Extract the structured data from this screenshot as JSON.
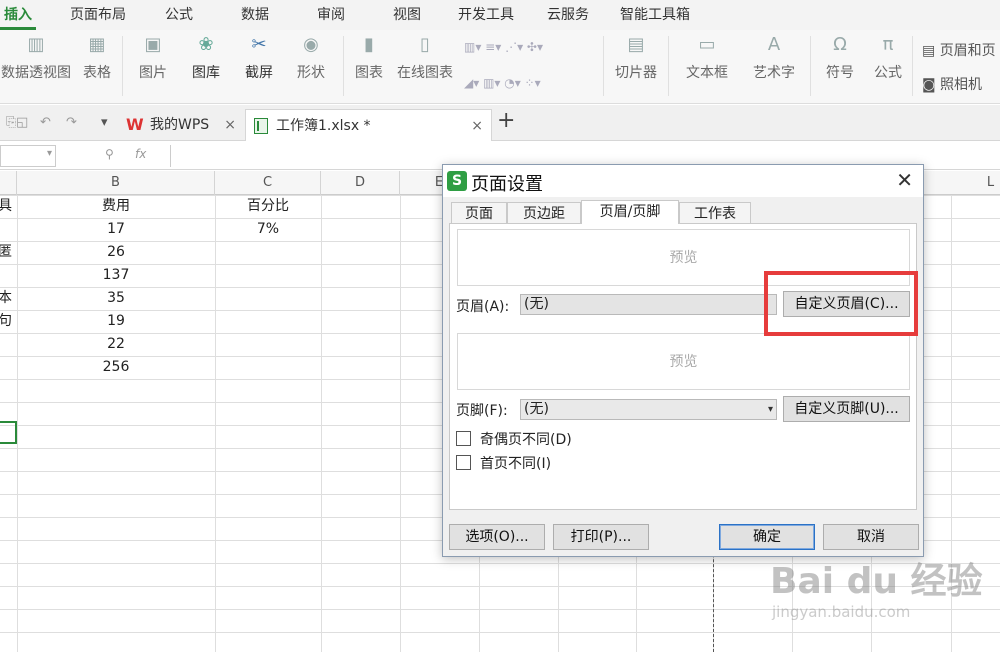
{
  "menu": {
    "tabs": [
      "插入",
      "页面布局",
      "公式",
      "数据",
      "审阅",
      "视图",
      "开发工具",
      "云服务",
      "智能工具箱"
    ],
    "active": "插入"
  },
  "ribbon": {
    "pivot": "数据透视图",
    "table": "表格",
    "picture": "图片",
    "gallery": "图库",
    "screenshot": "截屏",
    "shapes": "形状",
    "chart": "图表",
    "online_chart": "在线图表",
    "slicer": "切片器",
    "textbox": "文本框",
    "wordart": "艺术字",
    "symbol": "符号",
    "formula": "公式",
    "header_footer": "页眉和页",
    "camera": "照相机"
  },
  "doctabs": {
    "wps": "我的WPS",
    "workbook": "工作簿1.xlsx *"
  },
  "formula_bar": {
    "fx": "fx"
  },
  "columns": [
    "B",
    "C",
    "D",
    "E",
    "L"
  ],
  "sheet": {
    "col_a_fragments": [
      "具",
      "匿",
      "",
      "本",
      "句",
      "",
      ""
    ],
    "header_b": "费用",
    "header_c": "百分比",
    "values_b": [
      "17",
      "26",
      "137",
      "35",
      "19",
      "22",
      "256"
    ],
    "value_c1": "7%"
  },
  "dialog": {
    "title": "页面设置",
    "tabs": [
      "页面",
      "页边距",
      "页眉/页脚",
      "工作表"
    ],
    "active_tab": "页眉/页脚",
    "preview": "预览",
    "header_label": "页眉(A):",
    "header_value": "(无)",
    "custom_header": "自定义页眉(C)...",
    "footer_label": "页脚(F):",
    "footer_value": "(无)",
    "custom_footer": "自定义页脚(U)...",
    "odd_even": "奇偶页不同(D)",
    "first_page": "首页不同(I)",
    "options": "选项(O)...",
    "print": "打印(P)...",
    "ok": "确定",
    "cancel": "取消"
  },
  "watermark": {
    "main": "Bai du 经验",
    "sub": "jingyan.baidu.com"
  },
  "colors": {
    "accent": "#2a8a3a",
    "highlight": "#e63c3c"
  }
}
